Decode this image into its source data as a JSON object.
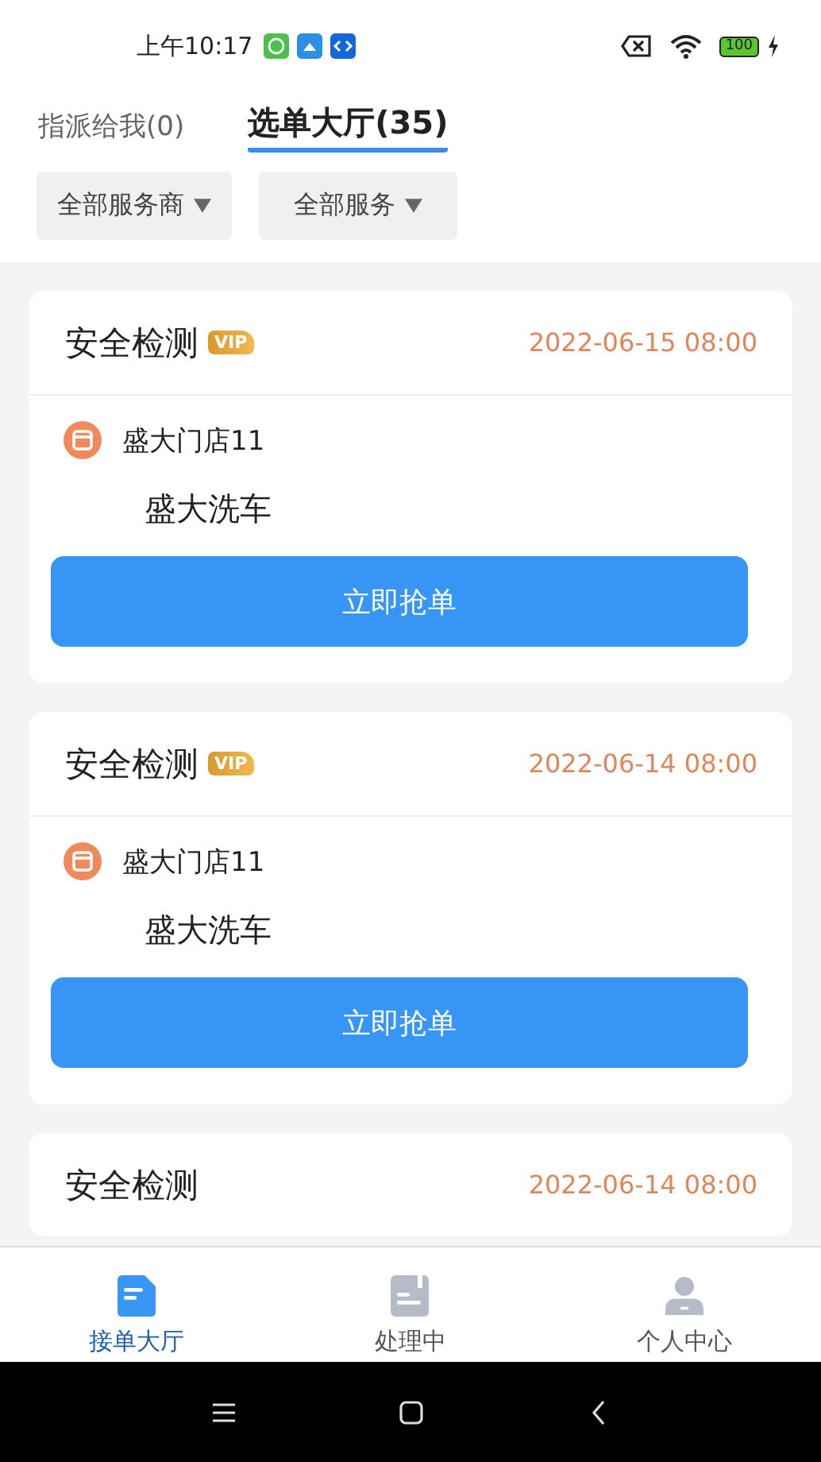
{
  "status_bar": {
    "time": "上午10:17",
    "battery": "100"
  },
  "tabs": [
    {
      "label": "指派给我(0)",
      "selected": false
    },
    {
      "label": "选单大厅(35)",
      "selected": true
    }
  ],
  "filters": [
    {
      "label": "全部服务商"
    },
    {
      "label": "全部服务"
    }
  ],
  "orders": [
    {
      "title": "安全检测",
      "vip": true,
      "badge": "VIP",
      "time": "2022-06-15 08:00",
      "store": "盛大门店11",
      "service": "盛大洗车",
      "action": "立即抢单"
    },
    {
      "title": "安全检测",
      "vip": true,
      "badge": "VIP",
      "time": "2022-06-14 08:00",
      "store": "盛大门店11",
      "service": "盛大洗车",
      "action": "立即抢单"
    },
    {
      "title": "安全检测",
      "vip": false,
      "time": "2022-06-14 08:00"
    }
  ],
  "bottom_nav": [
    {
      "label": "接单大厅",
      "kind": "hall",
      "selected": true
    },
    {
      "label": "处理中",
      "kind": "processing",
      "selected": false
    },
    {
      "label": "个人中心",
      "kind": "profile",
      "selected": false
    }
  ]
}
